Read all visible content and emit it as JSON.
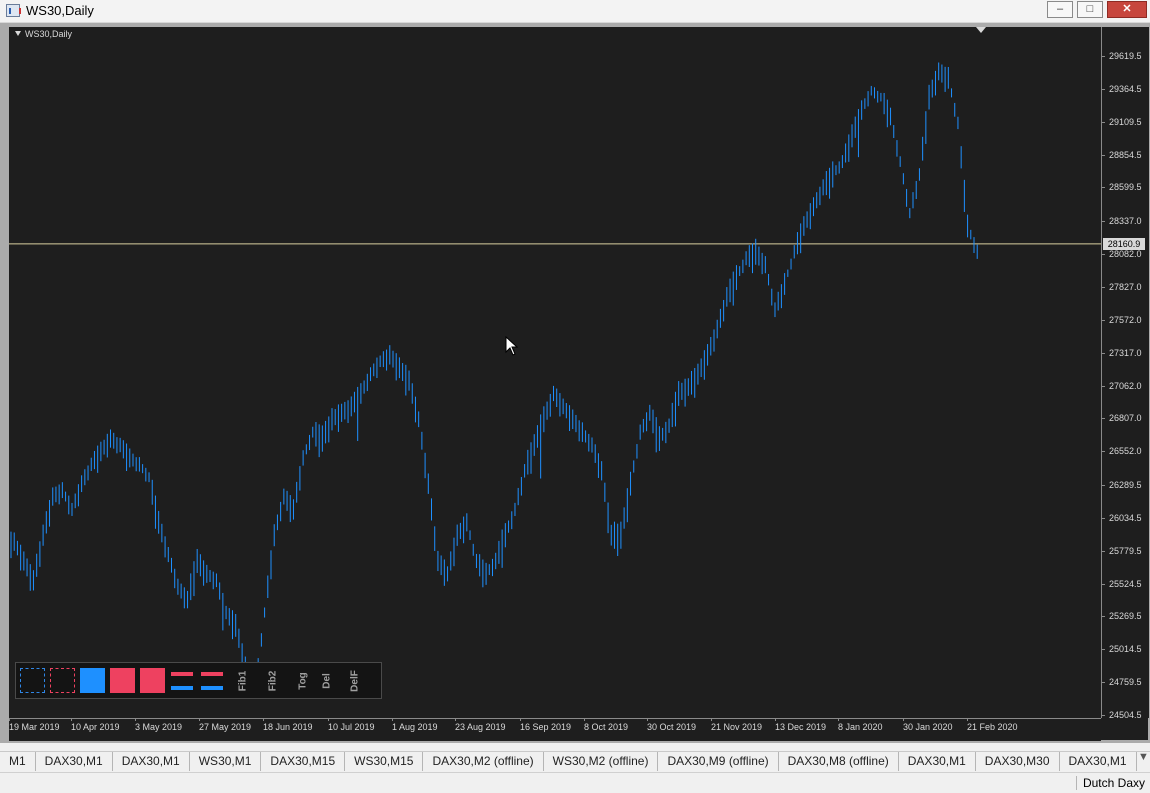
{
  "window": {
    "title": "WS30,Daily",
    "minimize_glyph": "–",
    "maximize_glyph": "□",
    "close_glyph": "✕"
  },
  "chart": {
    "label": "WS30,Daily",
    "current_price_label": "28160.9"
  },
  "chart_data": {
    "type": "bar",
    "symbol": "WS30",
    "timeframe": "Daily",
    "ylim": [
      24504.5,
      29619.5
    ],
    "current_price": 28160.9,
    "y_ticks": [
      "29619.5",
      "29364.5",
      "29109.5",
      "28854.5",
      "28599.5",
      "28337.0",
      "28082.0",
      "27827.0",
      "27572.0",
      "27317.0",
      "27062.0",
      "26807.0",
      "26552.0",
      "26289.5",
      "26034.5",
      "25779.5",
      "25524.5",
      "25269.5",
      "25014.5",
      "24759.5",
      "24504.5"
    ],
    "x_ticks": [
      "19 Mar 2019",
      "10 Apr 2019",
      "3 May 2019",
      "27 May 2019",
      "18 Jun 2019",
      "10 Jul 2019",
      "1 Aug 2019",
      "23 Aug 2019",
      "16 Sep 2019",
      "8 Oct 2019",
      "30 Oct 2019",
      "21 Nov 2019",
      "13 Dec 2019",
      "8 Jan 2020",
      "30 Jan 2020",
      "21 Feb 2020"
    ],
    "series": [
      {
        "color": "#1e90ff",
        "closes": [
          25850,
          25700,
          25550,
          25900,
          26200,
          26250,
          26100,
          26300,
          26450,
          26550,
          26650,
          26600,
          26500,
          26450,
          26350,
          26000,
          25750,
          25500,
          25400,
          25700,
          25600,
          25550,
          25300,
          25200,
          24900,
          24700,
          25300,
          25900,
          26200,
          26100,
          26500,
          26700,
          26650,
          26800,
          26850,
          26900,
          27000,
          27150,
          27250,
          27300,
          27200,
          27100,
          26800,
          26300,
          25700,
          25600,
          25900,
          26000,
          25700,
          25600,
          25700,
          25900,
          26100,
          26400,
          26600,
          26800,
          27000,
          26900,
          26800,
          26700,
          26600,
          26400,
          25900,
          25900,
          26300,
          26700,
          26850,
          26650,
          26750,
          27000,
          27050,
          27150,
          27300,
          27500,
          27750,
          27900,
          28050,
          28100,
          28000,
          27650,
          27850,
          28100,
          28300,
          28450,
          28600,
          28700,
          28800,
          29000,
          29200,
          29350,
          29300,
          29150,
          28800,
          28400,
          28700,
          29300,
          29500,
          29450,
          29100,
          28300,
          28100
        ]
      }
    ],
    "x_labels_map": "101 daily bars, 19 Mar 2019 to 21 Feb 2020"
  },
  "toolbox": {
    "buttons": [
      {
        "kind": "dash-blue"
      },
      {
        "kind": "dash-red"
      },
      {
        "kind": "solid-blue"
      },
      {
        "kind": "solid-red"
      },
      {
        "kind": "solid-red"
      },
      {
        "kind": "lines"
      },
      {
        "kind": "lines"
      }
    ],
    "text_buttons": [
      "Fib1",
      "Fib2",
      "Tog",
      "Del",
      "DelF"
    ]
  },
  "tabs": [
    "M1",
    "DAX30,M1",
    "DAX30,M1",
    "WS30,M1",
    "DAX30,M15",
    "WS30,M15",
    "DAX30,M2 (offline)",
    "WS30,M2 (offline)",
    "DAX30,M9 (offline)",
    "DAX30,M8 (offline)",
    "DAX30,M1",
    "DAX30,M30",
    "DAX30,M1"
  ],
  "statusbar": {
    "profile": "Dutch Daxy"
  },
  "colors": {
    "background": "#1e1e1e",
    "bars": "#1e90ff",
    "price_line": "#d9d0a0",
    "axis_text": "#d9d9d9"
  }
}
